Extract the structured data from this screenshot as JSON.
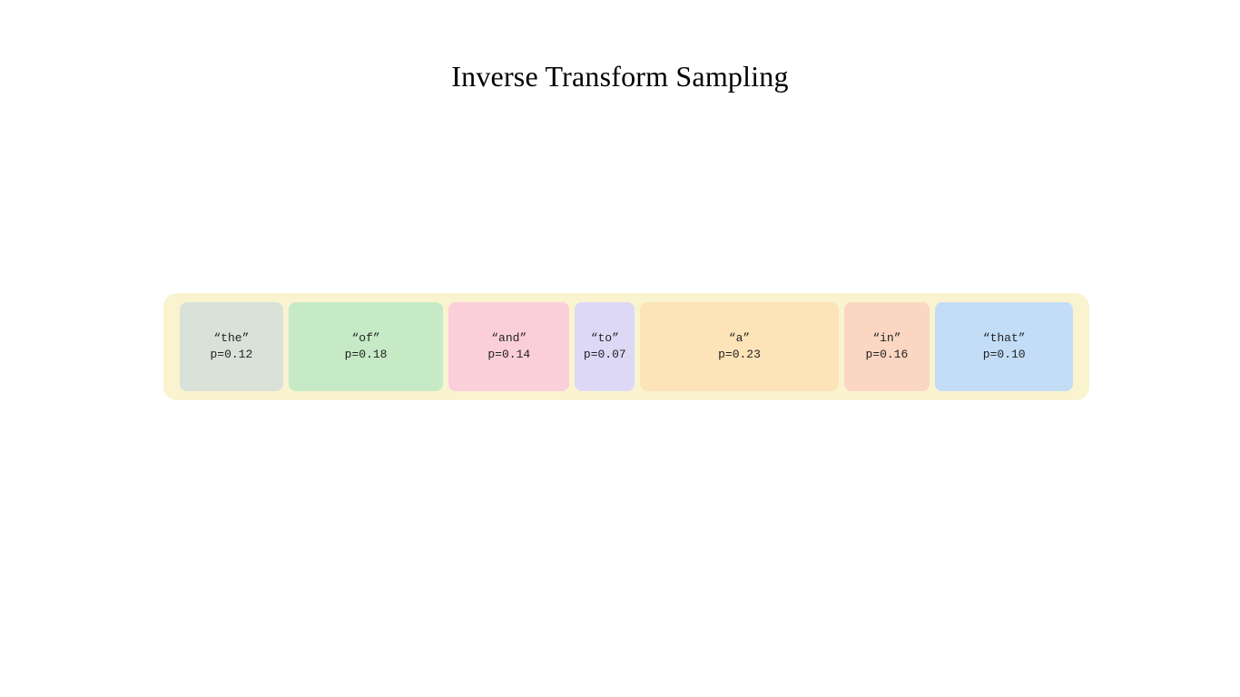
{
  "title": "Inverse Transform Sampling",
  "container_bg": "#faf3cf",
  "segments": [
    {
      "token": "“the”",
      "p_label": "p=0.12",
      "p": 0.12,
      "color": "#d9e1d9"
    },
    {
      "token": "“of”",
      "p_label": "p=0.18",
      "p": 0.18,
      "color": "#c6eac6"
    },
    {
      "token": "“and”",
      "p_label": "p=0.14",
      "p": 0.14,
      "color": "#fbcfd9"
    },
    {
      "token": "“to”",
      "p_label": "p=0.07",
      "p": 0.07,
      "color": "#ded8f7"
    },
    {
      "token": "“a”",
      "p_label": "p=0.23",
      "p": 0.23,
      "color": "#fde4b8"
    },
    {
      "token": "“in”",
      "p_label": "p=0.16",
      "p": 0.1,
      "color": "#fbd6c2"
    },
    {
      "token": "“that”",
      "p_label": "p=0.10",
      "p": 0.16,
      "color": "#c3ddf7"
    }
  ],
  "chart_data": {
    "type": "bar",
    "title": "Inverse Transform Sampling",
    "xlabel": "",
    "ylabel": "",
    "categories": [
      "the",
      "of",
      "and",
      "to",
      "a",
      "in",
      "that"
    ],
    "values": [
      0.12,
      0.18,
      0.14,
      0.07,
      0.23,
      0.16,
      0.1
    ],
    "ylim": [
      0,
      0.25
    ],
    "note": "Width-proportional stacked horizontal segments representing token probabilities for inverse transform sampling."
  }
}
